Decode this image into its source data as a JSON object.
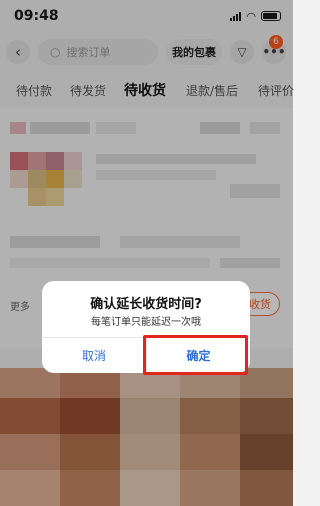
{
  "status_bar": {
    "time": "09:48"
  },
  "nav": {
    "search_placeholder": "搜索订单",
    "my_packages_label": "我的包裹",
    "more_badge": "6"
  },
  "tabs": [
    {
      "label": "待付款",
      "active": false
    },
    {
      "label": "待发货",
      "active": false
    },
    {
      "label": "待收货",
      "active": true
    },
    {
      "label": "退款/售后",
      "active": false
    },
    {
      "label": "待评价",
      "active": false
    }
  ],
  "order_card": {
    "more_label": "更多",
    "confirm_button_fragment": "收货"
  },
  "dialog": {
    "title": "确认延长收货时间?",
    "message": "每笔订单只能延迟一次哦",
    "cancel_label": "取消",
    "confirm_label": "确定"
  },
  "colors": {
    "accent": "#2f6fd6",
    "highlight": "#e0261f",
    "brand": "#ff5a1f"
  }
}
